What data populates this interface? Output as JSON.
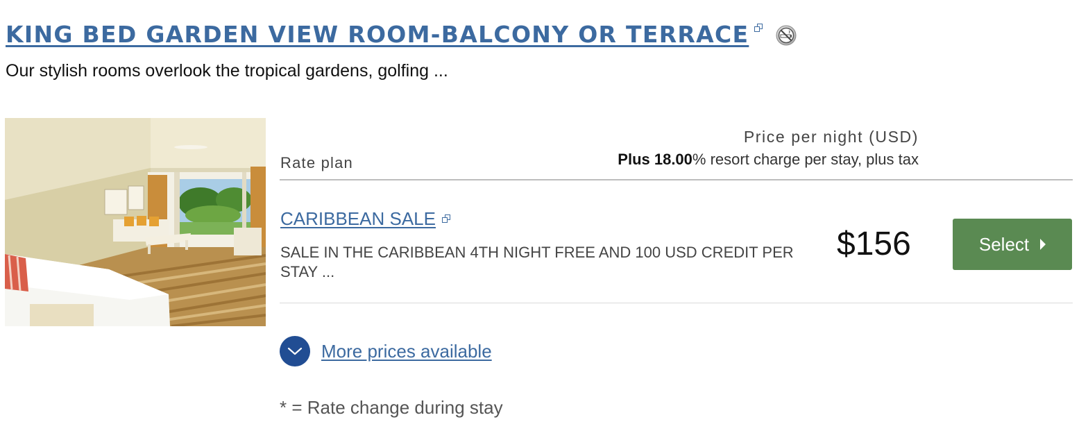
{
  "room": {
    "title": "KING BED GARDEN VIEW ROOM-BALCONY OR TERRACE",
    "description": "Our stylish rooms overlook the tropical gardens, golfing ...",
    "title_link_icon": "external-link-icon",
    "amenity_icon": "no-smoking-icon",
    "photo_description": "Hotel room with white bed, sofa and open balcony"
  },
  "rate_table": {
    "rate_plan_label": "Rate plan",
    "price_per_night_label": "Price per night (USD)",
    "resort_charge_prefix": "Plus 18.00",
    "resort_charge_suffix": "% resort charge per stay, plus tax"
  },
  "rate": {
    "name": "CARIBBEAN SALE",
    "description": "SALE IN THE CARIBBEAN 4TH NIGHT FREE AND 100 USD CREDIT PER STAY ...",
    "price": "$156",
    "select_label": "Select",
    "link_icon": "external-link-icon"
  },
  "more_prices": {
    "label": "More prices available",
    "icon": "chevron-down-icon"
  },
  "footnote": "* = Rate change during stay",
  "colors": {
    "link": "#3c6aa0",
    "select_button": "#5a8a52",
    "more_circle": "#214d93"
  }
}
